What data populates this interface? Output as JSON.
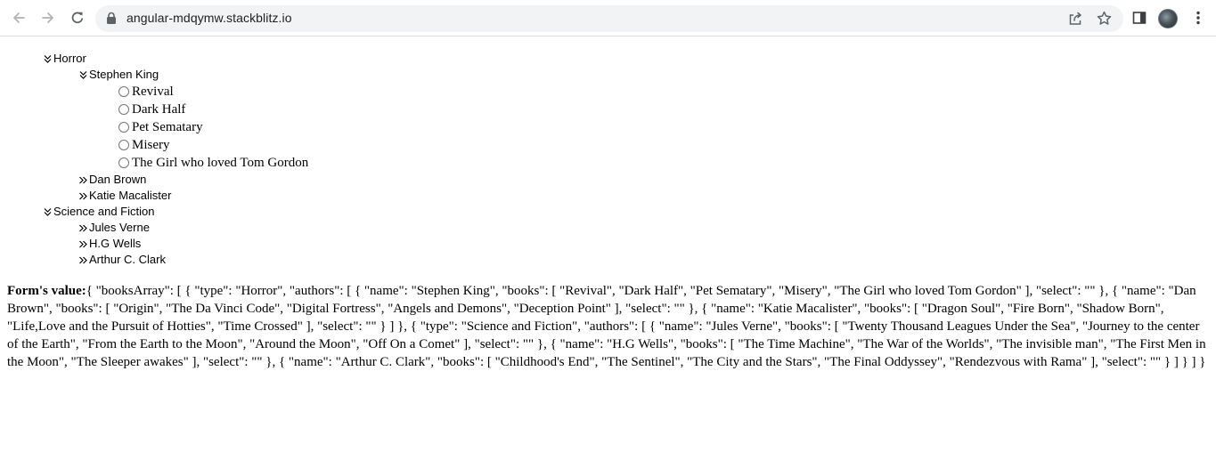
{
  "browser": {
    "url": "angular-mdqymw.stackblitz.io",
    "icons": [
      "back-arrow-icon",
      "forward-arrow-icon",
      "reload-icon",
      "lock-icon",
      "share-icon",
      "star-icon",
      "side-panel-icon",
      "profile-avatar",
      "kebab-menu-icon"
    ]
  },
  "tree": {
    "horror": {
      "label": "Horror",
      "state": "expanded",
      "stephen_king": {
        "label": "Stephen King",
        "state": "expanded",
        "books": [
          "Revival",
          "Dark Half",
          "Pet Sematary",
          "Misery",
          "The Girl who loved Tom Gordon"
        ]
      },
      "dan_brown": {
        "label": "Dan Brown",
        "state": "collapsed"
      },
      "katie_macalister": {
        "label": "Katie Macalister",
        "state": "collapsed"
      }
    },
    "scifi": {
      "label": "Science and Fiction",
      "state": "expanded",
      "jules_verne": {
        "label": "Jules Verne",
        "state": "collapsed"
      },
      "hg_wells": {
        "label": "H.G Wells",
        "state": "collapsed"
      },
      "arthur_clark": {
        "label": "Arthur C. Clark",
        "state": "collapsed"
      }
    }
  },
  "form": {
    "label": "Form's value:",
    "value": "{ \"booksArray\": [ { \"type\": \"Horror\", \"authors\": [ { \"name\": \"Stephen King\", \"books\": [ \"Revival\", \"Dark Half\", \"Pet Sematary\", \"Misery\", \"The Girl who loved Tom Gordon\" ], \"select\": \"\" }, { \"name\": \"Dan Brown\", \"books\": [ \"Origin\", \"The Da Vinci Code\", \"Digital Fortress\", \"Angels and Demons\", \"Deception Point\" ], \"select\": \"\" }, { \"name\": \"Katie Macalister\", \"books\": [ \"Dragon Soul\", \"Fire Born\", \"Shadow Born\", \"Life,Love and the Pursuit of Hotties\", \"Time Crossed\" ], \"select\": \"\" } ] }, { \"type\": \"Science and Fiction\", \"authors\": [ { \"name\": \"Jules Verne\", \"books\": [ \"Twenty Thousand Leagues Under the Sea\", \"Journey to the center of the Earth\", \"From the Earth to the Moon\", \"Around the Moon\", \"Off On a Comet\" ], \"select\": \"\" }, { \"name\": \"H.G Wells\", \"books\": [ \"The Time Machine\", \"The War of the Worlds\", \"The invisible man\", \"The First Men in the Moon\", \"The Sleeper awakes\" ], \"select\": \"\" }, { \"name\": \"Arthur C. Clark\", \"books\": [ \"Childhood's End\", \"The Sentinel\", \"The City and the Stars\", \"The Final Oddyssey\", \"Rendezvous with Rama\" ], \"select\": \"\" } ] } ] }"
  }
}
